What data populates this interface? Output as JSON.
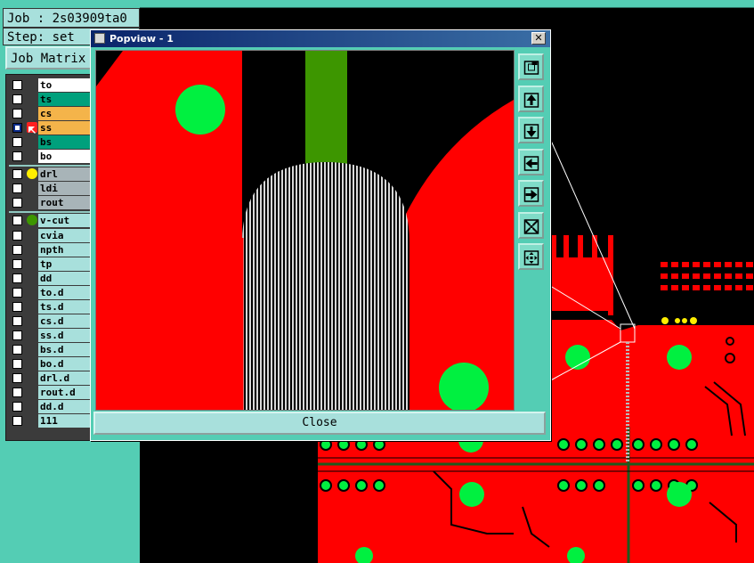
{
  "header": {
    "job_label": "Job : 2s03909ta0",
    "step_label": "Step: set",
    "matrix_button": "Job Matrix"
  },
  "layers": [
    {
      "name": "to",
      "color": "#ffffff",
      "marker": "",
      "active": false
    },
    {
      "name": "ts",
      "color": "#00a07c",
      "marker": "",
      "active": false
    },
    {
      "name": "cs",
      "color": "#f4b44a",
      "marker": "",
      "active": false
    },
    {
      "name": "ss",
      "color": "#f4b44a",
      "marker": "cursor-arrow-icon",
      "active": true
    },
    {
      "name": "bs",
      "color": "#00a07c",
      "marker": "",
      "active": false
    },
    {
      "name": "bo",
      "color": "#ffffff",
      "marker": "",
      "active": false
    },
    {
      "name": "drl",
      "color": "#a8b4b8",
      "marker": "yellow-dot",
      "active": false
    },
    {
      "name": "ldi",
      "color": "#a8b4b8",
      "marker": "",
      "active": false
    },
    {
      "name": "rout",
      "color": "#a8b4b8",
      "marker": "",
      "active": false
    },
    {
      "name": "v-cut",
      "color": "#a8e0dc",
      "marker": "green-dot",
      "active": false
    },
    {
      "name": "cvia",
      "color": "#a8e0dc",
      "marker": "",
      "active": false
    },
    {
      "name": "npth",
      "color": "#a8e0dc",
      "marker": "",
      "active": false
    },
    {
      "name": "tp",
      "color": "#a8e0dc",
      "marker": "",
      "active": false
    },
    {
      "name": "dd",
      "color": "#a8e0dc",
      "marker": "",
      "active": false
    },
    {
      "name": "to.d",
      "color": "#a8e0dc",
      "marker": "",
      "active": false
    },
    {
      "name": "ts.d",
      "color": "#a8e0dc",
      "marker": "",
      "active": false
    },
    {
      "name": "cs.d",
      "color": "#a8e0dc",
      "marker": "",
      "active": false
    },
    {
      "name": "ss.d",
      "color": "#a8e0dc",
      "marker": "",
      "active": false
    },
    {
      "name": "bs.d",
      "color": "#a8e0dc",
      "marker": "",
      "active": false
    },
    {
      "name": "bo.d",
      "color": "#a8e0dc",
      "marker": "",
      "active": false
    },
    {
      "name": "drl.d",
      "color": "#a8e0dc",
      "marker": "",
      "active": false
    },
    {
      "name": "rout.d",
      "color": "#a8e0dc",
      "marker": "",
      "active": false
    },
    {
      "name": "dd.d",
      "color": "#a8e0dc",
      "marker": "",
      "active": false
    },
    {
      "name": "111",
      "color": "#a8e0dc",
      "marker": "",
      "active": false
    }
  ],
  "popview": {
    "title": "Popview - 1",
    "close_x": "✕",
    "close_button": "Close",
    "tools": [
      "zoom-fit-icon",
      "pan-up-icon",
      "pan-down-icon",
      "pan-left-icon",
      "pan-right-icon",
      "zoom-in-icon",
      "zoom-out-icon"
    ]
  },
  "colors": {
    "panel": "#54cdb4",
    "copper": "#ff0000",
    "pad": "#00f040",
    "silk": "#3d9600"
  }
}
